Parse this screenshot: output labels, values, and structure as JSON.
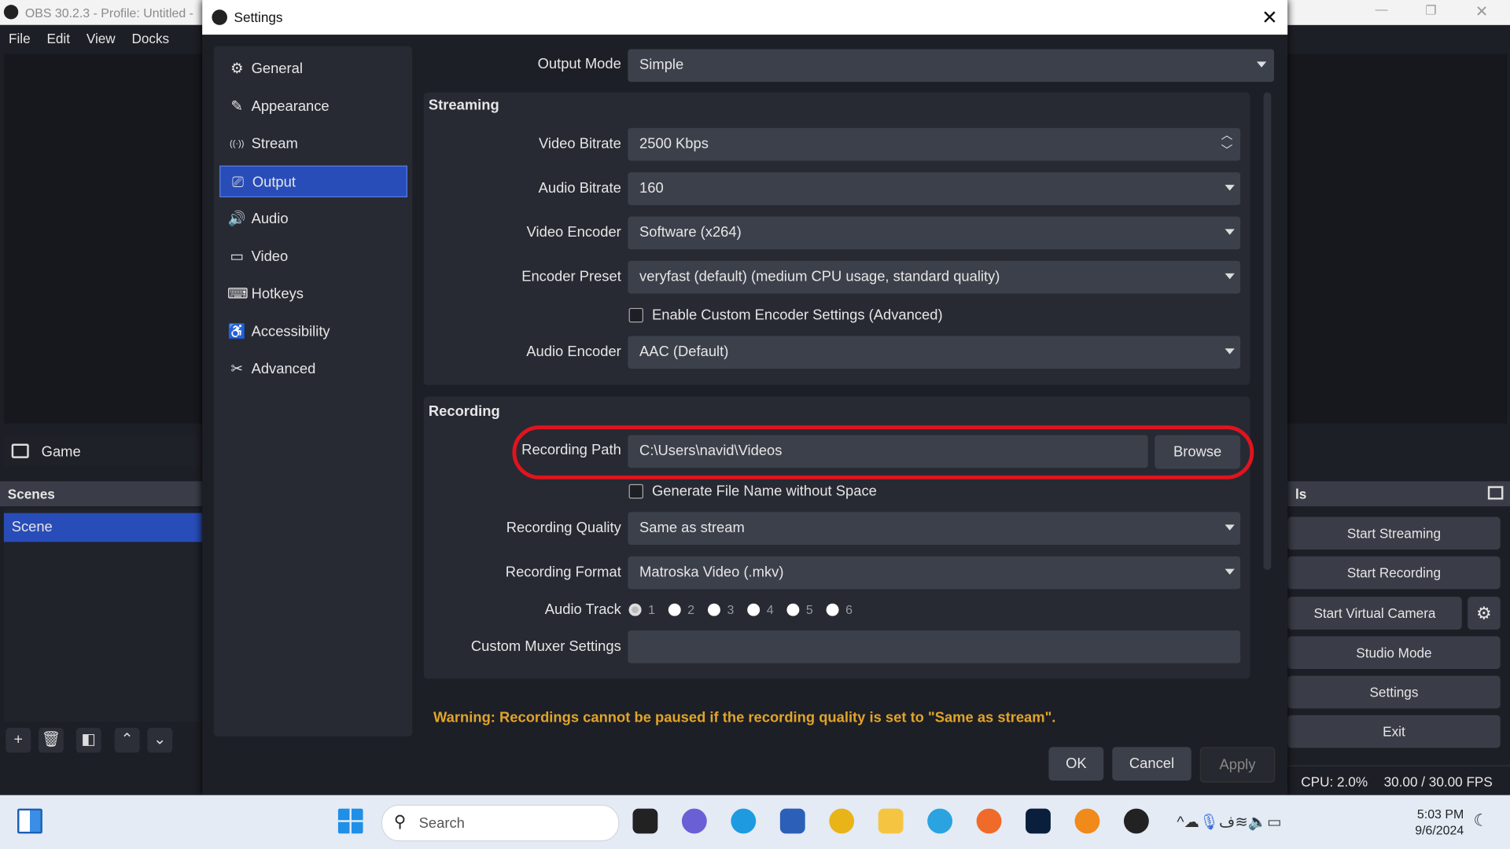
{
  "main_window": {
    "title": "OBS 30.2.3 - Profile: Untitled -",
    "menu": [
      "File",
      "Edit",
      "View",
      "Docks"
    ],
    "source": "Game",
    "scenes_header": "Scenes",
    "scenes": [
      "Scene"
    ],
    "controls_header": "ls",
    "controls": [
      "Start Streaming",
      "Start Recording",
      "Start Virtual Camera",
      "Studio Mode",
      "Settings",
      "Exit"
    ],
    "status": {
      "cpu": "CPU: 2.0%",
      "fps": "30.00 / 30.00 FPS"
    }
  },
  "dialog": {
    "title": "Settings",
    "nav": [
      {
        "label": "General",
        "icon": "gear-icon"
      },
      {
        "label": "Appearance",
        "icon": "appearance-icon"
      },
      {
        "label": "Stream",
        "icon": "antenna-icon"
      },
      {
        "label": "Output",
        "icon": "output-icon",
        "selected": true
      },
      {
        "label": "Audio",
        "icon": "speaker-icon"
      },
      {
        "label": "Video",
        "icon": "monitor-icon"
      },
      {
        "label": "Hotkeys",
        "icon": "keyboard-icon"
      },
      {
        "label": "Accessibility",
        "icon": "accessibility-icon"
      },
      {
        "label": "Advanced",
        "icon": "tools-icon"
      }
    ],
    "output_mode": {
      "label": "Output Mode",
      "value": "Simple"
    },
    "streaming": {
      "title": "Streaming",
      "video_bitrate": {
        "label": "Video Bitrate",
        "value": "2500 Kbps"
      },
      "audio_bitrate": {
        "label": "Audio Bitrate",
        "value": "160"
      },
      "video_encoder": {
        "label": "Video Encoder",
        "value": "Software (x264)"
      },
      "encoder_preset": {
        "label": "Encoder Preset",
        "value": "veryfast (default) (medium CPU usage, standard quality)"
      },
      "custom_encoder": {
        "label": "Enable Custom Encoder Settings (Advanced)",
        "checked": false
      },
      "audio_encoder": {
        "label": "Audio Encoder",
        "value": "AAC (Default)"
      }
    },
    "recording": {
      "title": "Recording",
      "path": {
        "label": "Recording Path",
        "value": "C:\\Users\\navid\\Videos",
        "browse": "Browse"
      },
      "no_space": {
        "label": "Generate File Name without Space",
        "checked": false
      },
      "quality": {
        "label": "Recording Quality",
        "value": "Same as stream"
      },
      "format": {
        "label": "Recording Format",
        "value": "Matroska Video (.mkv)"
      },
      "audio_track": {
        "label": "Audio Track",
        "tracks": [
          "1",
          "2",
          "3",
          "4",
          "5",
          "6"
        ],
        "selected": "1"
      },
      "muxer": {
        "label": "Custom Muxer Settings",
        "value": ""
      }
    },
    "warning": "Warning: Recordings cannot be paused if the recording quality is set to \"Same as stream\".",
    "buttons": {
      "ok": "OK",
      "cancel": "Cancel",
      "apply": "Apply"
    },
    "highlight_color": "#e0141e",
    "warning_color": "#e0a42a",
    "accent": "#284cb8"
  },
  "taskbar": {
    "search_placeholder": "Search",
    "time": "5:03 PM",
    "date": "9/6/2024",
    "apps": [
      "file-explorer-icon",
      "teams-icon",
      "edge-icon",
      "word-icon",
      "chrome-icon",
      "folder-icon",
      "telegram-icon",
      "firefox-icon",
      "photoshop-icon",
      "vpn-icon",
      "obs-icon"
    ]
  }
}
